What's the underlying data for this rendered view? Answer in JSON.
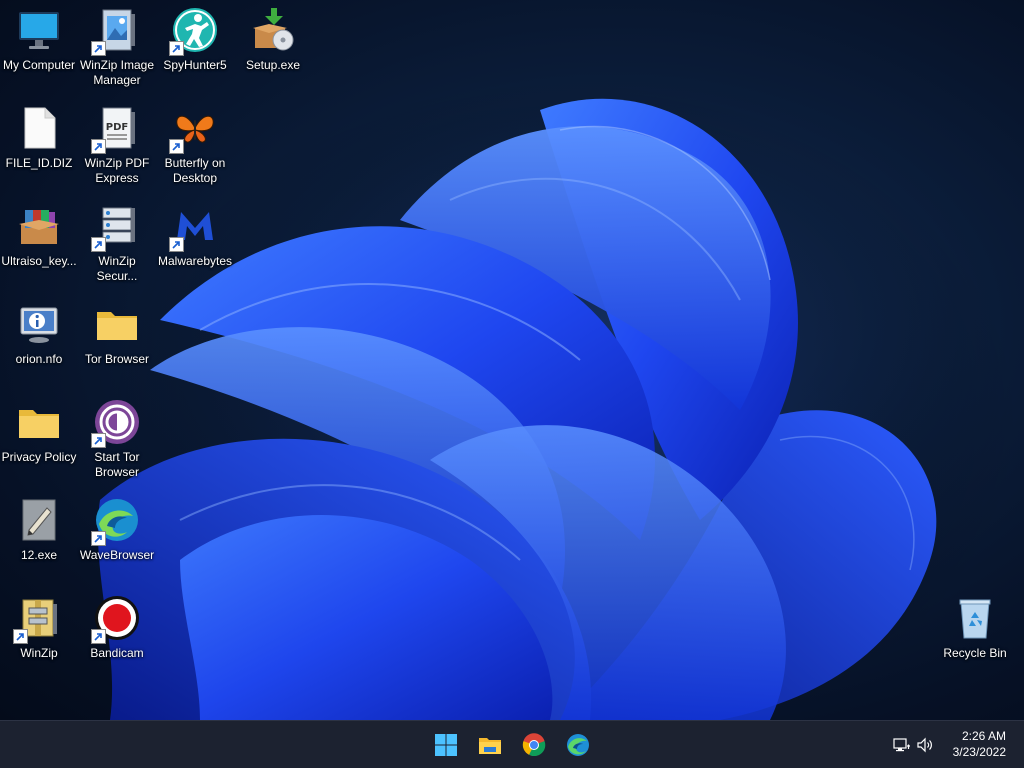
{
  "desktop": {
    "icons": [
      {
        "label": "My Computer",
        "icon": "monitor-icon",
        "shortcut": false
      },
      {
        "label": "WinZip Image Manager",
        "icon": "winzip-image-manager-icon",
        "shortcut": true
      },
      {
        "label": "SpyHunter5",
        "icon": "spyhunter-icon",
        "shortcut": true
      },
      {
        "label": "Setup.exe",
        "icon": "setup-installer-icon",
        "shortcut": false
      },
      {
        "label": "FILE_ID.DIZ",
        "icon": "blank-file-icon",
        "shortcut": false
      },
      {
        "label": "WinZip PDF Express",
        "icon": "winzip-pdf-icon",
        "shortcut": true
      },
      {
        "label": "Butterfly on Desktop",
        "icon": "butterfly-icon",
        "shortcut": true
      },
      {
        "label": "Ultraiso_key...",
        "icon": "rar-archive-icon",
        "shortcut": false
      },
      {
        "label": "WinZip Secur...",
        "icon": "winzip-secure-icon",
        "shortcut": true
      },
      {
        "label": "Malwarebytes",
        "icon": "malwarebytes-icon",
        "shortcut": true
      },
      {
        "label": "orion.nfo",
        "icon": "info-monitor-icon",
        "shortcut": false
      },
      {
        "label": "Tor Browser",
        "icon": "folder-icon",
        "shortcut": false
      },
      {
        "label": "Privacy Policy",
        "icon": "folder-icon",
        "shortcut": false
      },
      {
        "label": "Start Tor Browser",
        "icon": "tor-onion-icon",
        "shortcut": true
      },
      {
        "label": "12.exe",
        "icon": "exe-pencil-icon",
        "shortcut": false
      },
      {
        "label": "WaveBrowser",
        "icon": "wavebrowser-icon",
        "shortcut": true
      },
      {
        "label": "WinZip",
        "icon": "winzip-icon",
        "shortcut": true
      },
      {
        "label": "Bandicam",
        "icon": "bandicam-record-icon",
        "shortcut": true
      },
      {
        "label": "Recycle Bin",
        "icon": "recycle-bin-icon",
        "shortcut": false
      }
    ]
  },
  "taskbar": {
    "pinned": [
      {
        "name": "start-button",
        "icon": "windows-start-icon"
      },
      {
        "name": "file-explorer-button",
        "icon": "file-explorer-icon"
      },
      {
        "name": "chrome-button",
        "icon": "chrome-icon"
      },
      {
        "name": "edge-button",
        "icon": "edge-icon"
      }
    ],
    "tray": {
      "network_icon": "network-icon",
      "volume_icon": "volume-icon",
      "time": "2:26 AM",
      "date": "3/23/2022"
    }
  },
  "colors": {
    "accent": "#1e4fff",
    "taskbar_bg": "#1c2230"
  }
}
